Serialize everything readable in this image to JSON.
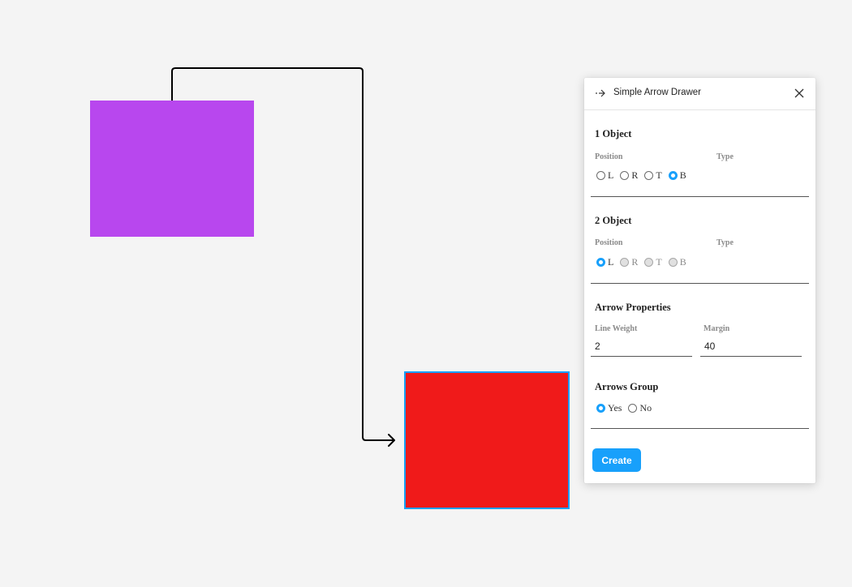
{
  "canvas": {
    "shapes": [
      {
        "name": "purple-rectangle",
        "color": "#b847ee"
      },
      {
        "name": "red-rectangle",
        "color": "#f01a1a",
        "selected": true,
        "selection_color": "#18a0fb"
      }
    ],
    "arrow": {
      "color": "#000000",
      "line_weight": 2
    }
  },
  "panel": {
    "title": "Simple Arrow Drawer",
    "icon": "arrow-right-icon",
    "object1": {
      "title": "1 Object",
      "position_label": "Position",
      "type_label": "Type",
      "options": [
        {
          "label": "L",
          "checked": false,
          "disabled": false
        },
        {
          "label": "R",
          "checked": false,
          "disabled": false
        },
        {
          "label": "T",
          "checked": false,
          "disabled": false
        },
        {
          "label": "B",
          "checked": true,
          "disabled": false
        }
      ]
    },
    "object2": {
      "title": "2 Object",
      "position_label": "Position",
      "type_label": "Type",
      "options": [
        {
          "label": "L",
          "checked": true,
          "disabled": false
        },
        {
          "label": "R",
          "checked": false,
          "disabled": true
        },
        {
          "label": "T",
          "checked": false,
          "disabled": true
        },
        {
          "label": "B",
          "checked": false,
          "disabled": true
        }
      ]
    },
    "arrow_properties": {
      "title": "Arrow Properties",
      "line_weight_label": "Line Weight",
      "line_weight_value": "2",
      "margin_label": "Margin",
      "margin_value": "40"
    },
    "arrows_group": {
      "title": "Arrows Group",
      "options": [
        {
          "label": "Yes",
          "checked": true
        },
        {
          "label": "No",
          "checked": false
        }
      ]
    },
    "create_label": "Create",
    "accent_color": "#18a0fb"
  }
}
